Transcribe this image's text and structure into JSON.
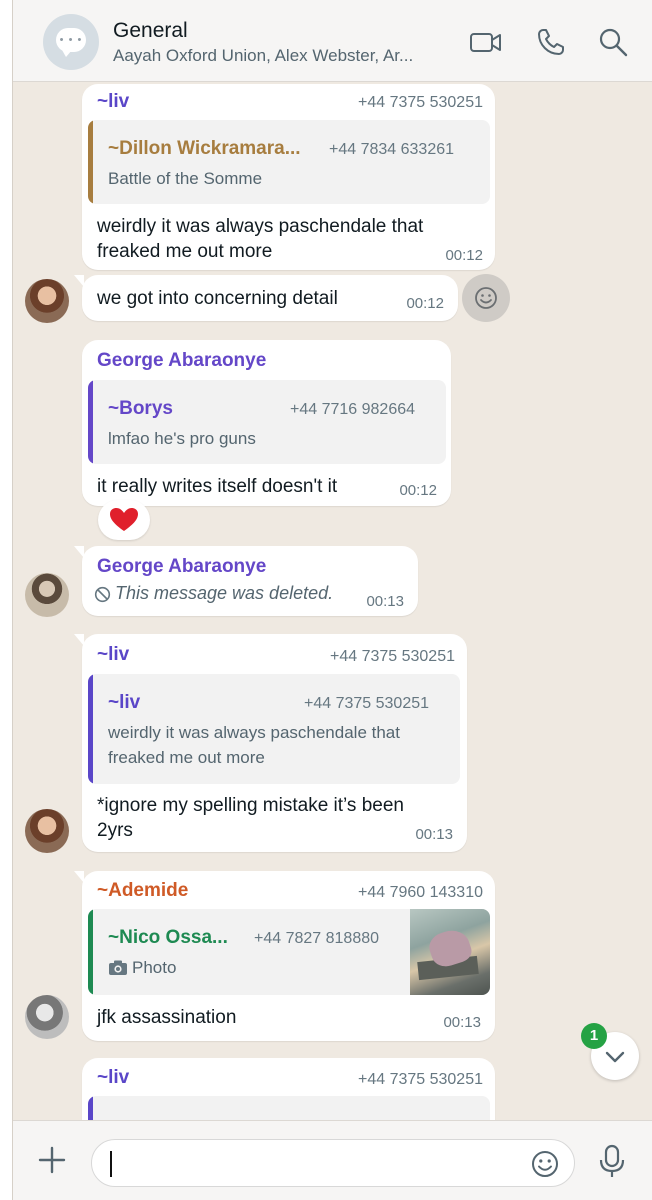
{
  "header": {
    "title": "General",
    "subtitle": "Aayah Oxford Union, Alex Webster, Ar..."
  },
  "colors": {
    "liv": "#5a46c8",
    "dillon": "#a77d3f",
    "george": "#6447c8",
    "borys": "#6447c8",
    "ademide": "#cf5a26",
    "nico": "#1e8a52",
    "wallpaper": "#efe9e1",
    "unread": "#25a244"
  },
  "messages": [
    {
      "sender": "~liv",
      "phone": "+44 7375 530251",
      "quote": {
        "name": "~Dillon Wickramara...",
        "phone": "+44 7834 633261",
        "text": "Battle of the Somme"
      },
      "text_lines": [
        "weirdly it was always paschendale that",
        "freaked me out more"
      ],
      "time": "00:12"
    },
    {
      "text_lines": [
        "we got into concerning detail"
      ],
      "time": "00:12"
    },
    {
      "sender": "George Abaraonye",
      "quote": {
        "name": "~Borys",
        "phone": "+44 7716 982664",
        "text": "lmfao he's pro guns"
      },
      "text_lines": [
        "it really writes itself doesn't it"
      ],
      "time": "00:12",
      "reaction": "❤️"
    },
    {
      "sender": "George Abaraonye",
      "deleted_text": "This message was deleted.",
      "time": "00:13"
    },
    {
      "sender": "~liv",
      "phone": "+44 7375 530251",
      "quote": {
        "name": "~liv",
        "phone": "+44 7375 530251",
        "text_lines": [
          "weirdly it was always paschendale that",
          "freaked me out more"
        ]
      },
      "text_lines": [
        "*ignore my spelling mistake it’s been",
        "2yrs"
      ],
      "time": "00:13"
    },
    {
      "sender": "~Ademide",
      "phone": "+44 7960 143310",
      "quote": {
        "name": "~Nico Ossa...",
        "phone": "+44 7827 818880",
        "text": "Photo"
      },
      "text_lines": [
        "jfk assassination"
      ],
      "time": "00:13"
    },
    {
      "sender": "~liv",
      "phone": "+44 7375 530251"
    }
  ],
  "scroll": {
    "unread_count": "1"
  },
  "composer": {
    "placeholder": ""
  }
}
